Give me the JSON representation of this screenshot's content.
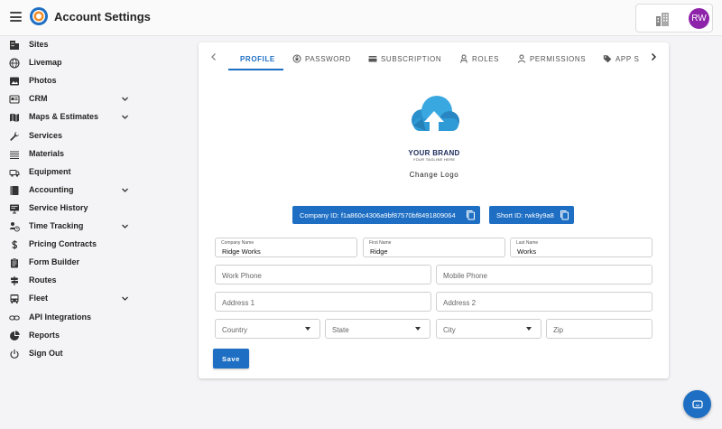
{
  "header": {
    "title": "Account Settings",
    "avatar_initials": "RW",
    "avatar_color": "#8e24aa"
  },
  "sidebar": {
    "items": [
      {
        "label": "Sites",
        "icon": "building-icon",
        "expandable": false
      },
      {
        "label": "Livemap",
        "icon": "globe-icon",
        "expandable": false
      },
      {
        "label": "Photos",
        "icon": "image-icon",
        "expandable": false
      },
      {
        "label": "CRM",
        "icon": "card-icon",
        "expandable": true
      },
      {
        "label": "Maps & Estimates",
        "icon": "map-icon",
        "expandable": true
      },
      {
        "label": "Services",
        "icon": "wrench-icon",
        "expandable": false
      },
      {
        "label": "Materials",
        "icon": "layers-icon",
        "expandable": false
      },
      {
        "label": "Equipment",
        "icon": "truck-icon",
        "expandable": false
      },
      {
        "label": "Accounting",
        "icon": "book-icon",
        "expandable": true
      },
      {
        "label": "Service History",
        "icon": "monitor-icon",
        "expandable": false
      },
      {
        "label": "Time Tracking",
        "icon": "clock-person-icon",
        "expandable": true
      },
      {
        "label": "Pricing Contracts",
        "icon": "dollar-icon",
        "expandable": false
      },
      {
        "label": "Form Builder",
        "icon": "clipboard-icon",
        "expandable": false
      },
      {
        "label": "Routes",
        "icon": "signpost-icon",
        "expandable": false
      },
      {
        "label": "Fleet",
        "icon": "bus-icon",
        "expandable": true
      },
      {
        "label": "API Integrations",
        "icon": "link-icon",
        "expandable": false
      },
      {
        "label": "Reports",
        "icon": "chart-icon",
        "expandable": false
      },
      {
        "label": "Sign Out",
        "icon": "power-icon",
        "expandable": false
      }
    ]
  },
  "tabs": [
    {
      "label": "PROFILE",
      "icon": "",
      "active": true
    },
    {
      "label": "PASSWORD",
      "icon": "lock-reset-icon",
      "active": false
    },
    {
      "label": "SUBSCRIPTION",
      "icon": "credit-card-icon",
      "active": false
    },
    {
      "label": "ROLES",
      "icon": "roles-icon",
      "active": false
    },
    {
      "label": "PERMISSIONS",
      "icon": "person-icon",
      "active": false
    },
    {
      "label": "APP S",
      "icon": "tag-icon",
      "active": false
    }
  ],
  "brand": {
    "name": "YOUR BRAND",
    "tagline": "YOUR TAGLINE HERE",
    "change_logo_label": "Change Logo"
  },
  "ids": {
    "company_id_label": "Company ID: f1a860c4306a9bf87570bf8491809064",
    "short_id_label": "Short ID: rwk9y9a8"
  },
  "form": {
    "company_name": {
      "label": "Company Name",
      "value": "Ridge Works"
    },
    "first_name": {
      "label": "First Name",
      "value": "Ridge"
    },
    "last_name": {
      "label": "Last Name",
      "value": "Works"
    },
    "work_phone": {
      "placeholder": "Work Phone"
    },
    "mobile_phone": {
      "placeholder": "Mobile Phone"
    },
    "address1": {
      "placeholder": "Address 1"
    },
    "address2": {
      "placeholder": "Address 2"
    },
    "country": {
      "placeholder": "Country"
    },
    "state": {
      "placeholder": "State"
    },
    "city": {
      "placeholder": "City"
    },
    "zip": {
      "placeholder": "Zip"
    },
    "save_label": "Save"
  },
  "colors": {
    "accent": "#1e6fc4",
    "brand_navy": "#1b2a5a",
    "brand_cloud": "#2f9bd6"
  }
}
